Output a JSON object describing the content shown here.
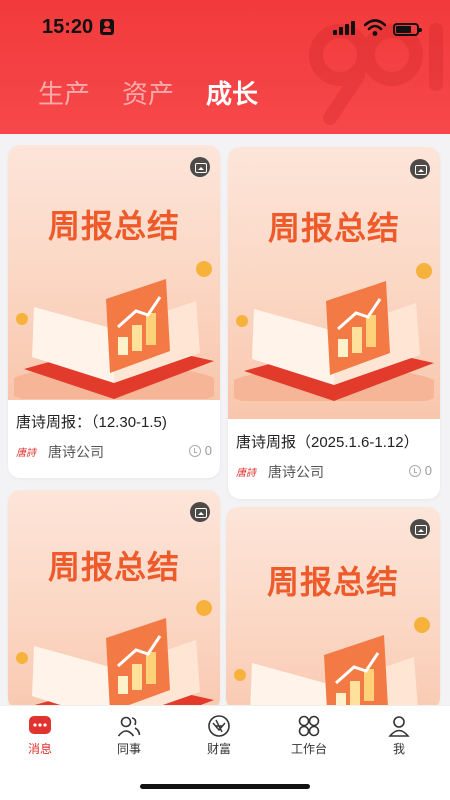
{
  "status_bar": {
    "time": "15:20"
  },
  "tabs": [
    {
      "label": "生产",
      "active": false
    },
    {
      "label": "资产",
      "active": false
    },
    {
      "label": "成长",
      "active": true
    }
  ],
  "cards": [
    {
      "thumb_title": "周报总结",
      "title": "唐诗周报：（12.30-1.5)",
      "brand_mark": "唐詩",
      "author": "唐诗公司",
      "views": "0"
    },
    {
      "thumb_title": "周报总结",
      "title": "唐诗周报（2025.1.6-1.12）",
      "brand_mark": "唐詩",
      "author": "唐诗公司",
      "views": "0"
    },
    {
      "thumb_title": "周报总结"
    },
    {
      "thumb_title": "周报总结"
    }
  ],
  "bottom_nav": [
    {
      "label": "消息",
      "icon": "message-icon",
      "active": true
    },
    {
      "label": "同事",
      "icon": "colleagues-icon",
      "active": false
    },
    {
      "label": "财富",
      "icon": "wealth-icon",
      "active": false
    },
    {
      "label": "工作台",
      "icon": "workbench-icon",
      "active": false
    },
    {
      "label": "我",
      "icon": "profile-icon",
      "active": false
    }
  ],
  "colors": {
    "brand_red": "#f23a3c",
    "thumb_orange": "#ef5a2a",
    "nav_active": "#e0332f"
  }
}
